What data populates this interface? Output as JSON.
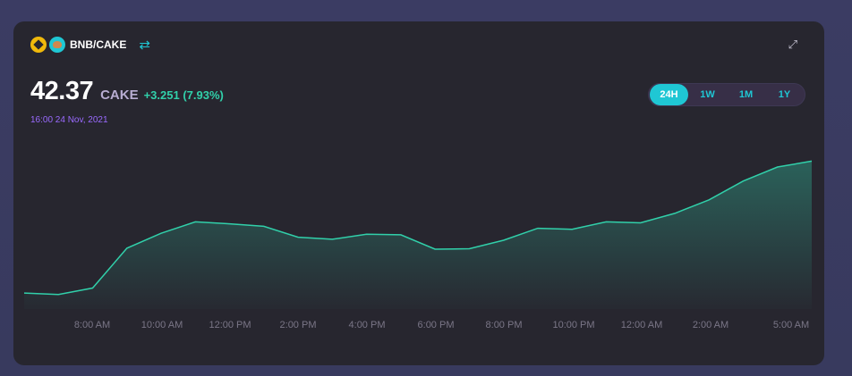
{
  "header": {
    "pair_label": "BNB/CAKE",
    "tokens": [
      "bnb-token-icon",
      "cake-token-icon"
    ],
    "swap_icon": "swap-arrows-icon",
    "expand_icon": "expand-icon"
  },
  "price": {
    "value": "42.37",
    "unit": "CAKE",
    "change": "+3.251 (7.93%)",
    "date": "16:00 24 Nov, 2021"
  },
  "tabs": [
    {
      "label": "24H",
      "active": true
    },
    {
      "label": "1W",
      "active": false
    },
    {
      "label": "1M",
      "active": false
    },
    {
      "label": "1Y",
      "active": false
    }
  ],
  "colors": {
    "accent": "#1fc7d4",
    "line": "#31d0aa",
    "secondary": "#9a6aff",
    "card": "#27262f"
  },
  "chart_data": {
    "type": "area",
    "x_labels": [
      "8:00 AM",
      "10:00 AM",
      "12:00 PM",
      "2:00 PM",
      "4:00 PM",
      "6:00 PM",
      "8:00 PM",
      "10:00 PM",
      "12:00 AM",
      "2:00 AM",
      "5:00 AM"
    ],
    "values": [
      38.95,
      38.92,
      39.05,
      39.85,
      40.15,
      40.38,
      40.34,
      40.29,
      40.07,
      40.03,
      40.13,
      40.12,
      39.83,
      39.84,
      40.01,
      40.25,
      40.23,
      40.38,
      40.36,
      40.55,
      40.82,
      41.2,
      41.48,
      41.6
    ],
    "ylim": [
      38.7,
      41.75
    ],
    "grid": false
  }
}
